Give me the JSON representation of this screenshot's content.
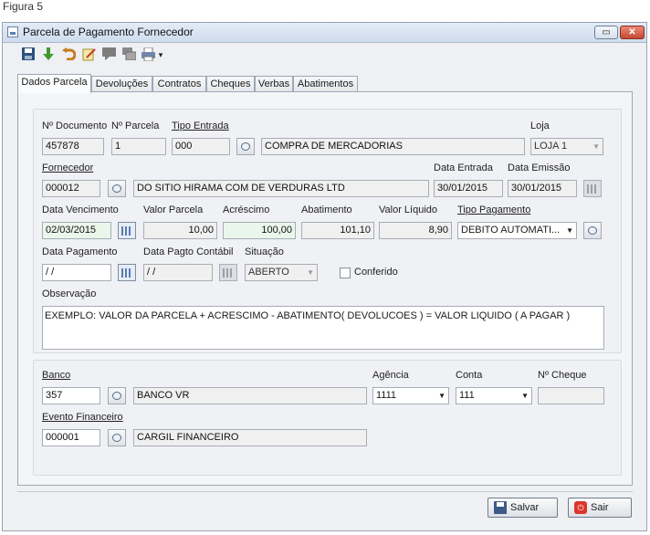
{
  "caption": "Figura 5",
  "window": {
    "title": "Parcela de Pagamento Fornecedor",
    "restore_glyph": "▭",
    "close_glyph": "✕"
  },
  "toolbar": {
    "icons": [
      "save-icon",
      "down-arrow-icon",
      "undo-icon",
      "edit-note-icon",
      "comment-icon",
      "layers-icon",
      "print-icon"
    ],
    "dropdown_glyph": "▾"
  },
  "tabs": [
    "Dados Parcela",
    "Devoluções",
    "Contratos",
    "Cheques",
    "Verbas",
    "Abatimentos"
  ],
  "labels": {
    "num_documento": "Nº Documento",
    "num_parcela": "Nº Parcela",
    "tipo_entrada": "Tipo Entrada",
    "loja": "Loja",
    "fornecedor": "Fornecedor",
    "data_entrada": "Data Entrada",
    "data_emissao": "Data Emissão",
    "data_vencimento": "Data Vencimento",
    "valor_parcela": "Valor Parcela",
    "acrescimo": "Acréscimo",
    "abatimento": "Abatimento",
    "valor_liquido": "Valor Líquido",
    "tipo_pagamento": "Tipo Pagamento",
    "data_pagamento": "Data Pagamento",
    "data_pagto_contabil": "Data Pagto Contábil",
    "situacao": "Situação",
    "conferido": "Conferido",
    "observacao": "Observação",
    "banco": "Banco",
    "agencia": "Agência",
    "conta": "Conta",
    "num_cheque": "Nº Cheque",
    "evento_financeiro": "Evento Financeiro"
  },
  "values": {
    "num_documento": "457878",
    "num_parcela": "1",
    "tipo_entrada_code": "000",
    "tipo_entrada_desc": "COMPRA DE MERCADORIAS",
    "loja": "LOJA 1",
    "fornecedor_code": "000012",
    "fornecedor_name": "DO SITIO HIRAMA COM DE VERDURAS LTD",
    "data_entrada": "30/01/2015",
    "data_emissao": "30/01/2015",
    "data_vencimento": "02/03/2015",
    "valor_parcela": "10,00",
    "acrescimo": "100,00",
    "abatimento": "101,10",
    "valor_liquido": "8,90",
    "tipo_pagamento": "DEBITO AUTOMATI...",
    "data_pagamento": " / /",
    "data_pagto_contabil": " / /",
    "situacao": "ABERTO",
    "observacao": "EXEMPLO: VALOR DA PARCELA + ACRESCIMO - ABATIMENTO( DEVOLUCOES ) = VALOR LIQUIDO ( A PAGAR )",
    "banco_code": "357",
    "banco_name": "BANCO VR",
    "agencia": "1111",
    "conta": "111",
    "num_cheque": "",
    "evento_code": "000001",
    "evento_name": "CARGIL FINANCEIRO"
  },
  "buttons": {
    "salvar": "Salvar",
    "sair": "Sair"
  }
}
